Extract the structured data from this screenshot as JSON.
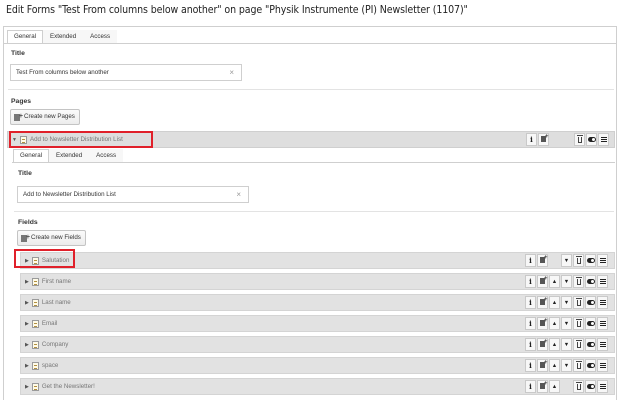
{
  "page": {
    "heading": "Edit Forms \"Test From columns below another\" on page \"Physik Instrumente (PI) Newsletter (1107)\""
  },
  "outer_tabs": [
    "General",
    "Extended",
    "Access"
  ],
  "title_label": "Title",
  "title_value": "Test From columns below another",
  "pages_label": "Pages",
  "create_pages_label": "Create new Pages",
  "page_item": {
    "title": "Add to Newsletter Distribution List",
    "tabs": [
      "General",
      "Extended",
      "Access"
    ],
    "title_label": "Title",
    "title_value": "Add to Newsletter Distribution List",
    "fields_label": "Fields",
    "create_fields_label": "Create new Fields"
  },
  "fields": [
    {
      "label": "Salutation",
      "up": false,
      "down": true
    },
    {
      "label": "First name",
      "up": true,
      "down": true
    },
    {
      "label": "Last name",
      "up": true,
      "down": true
    },
    {
      "label": "Email",
      "up": true,
      "down": true
    },
    {
      "label": "Company",
      "up": true,
      "down": true
    },
    {
      "label": "space",
      "up": true,
      "down": true
    },
    {
      "label": "Get the Newsletter!",
      "up": true,
      "down": false
    }
  ],
  "icons": {
    "info": "info-icon",
    "new_after": "new-record-icon",
    "move_up": "arrow-up-icon",
    "move_down": "arrow-down-icon",
    "delete": "trash-icon",
    "toggle": "toggle-visibility-icon",
    "drag": "drag-handle-icon",
    "expand": "caret-right-icon",
    "collapse": "caret-down-icon",
    "record": "document-icon"
  },
  "colors": {
    "highlight": "#e0202a",
    "row_background": "#e2e2e2",
    "header_background": "#dedede"
  }
}
